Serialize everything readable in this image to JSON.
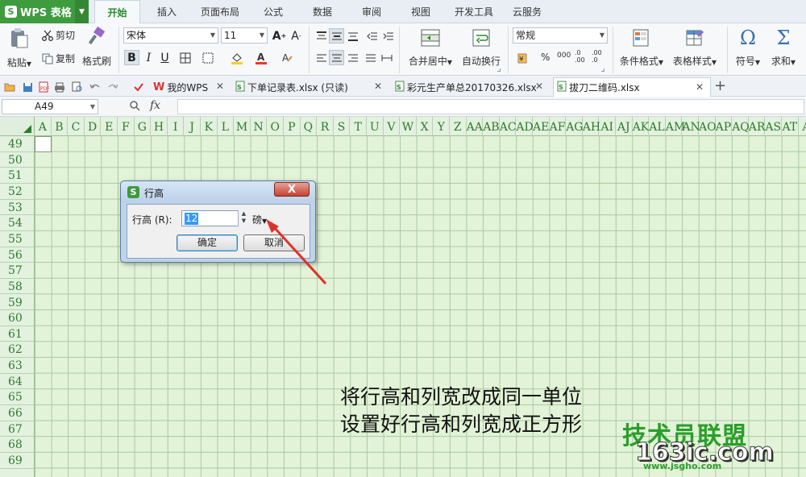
{
  "app": {
    "name": "WPS 表格",
    "logo_letter": "S"
  },
  "menu_tabs": [
    "开始",
    "插入",
    "页面布局",
    "公式",
    "数据",
    "审阅",
    "视图",
    "开发工具",
    "云服务"
  ],
  "active_tab": "开始",
  "ribbon": {
    "clipboard": {
      "paste": "粘贴",
      "cut": "剪切",
      "copy": "复制",
      "format_painter": "格式刷"
    },
    "font": {
      "name": "宋体",
      "size": "11",
      "bold": "B",
      "italic": "I",
      "underline": "U"
    },
    "merge_center": "合并居中",
    "wrap_text": "自动换行",
    "number_format": "常规",
    "percent": "%",
    "thousands": "000",
    "decimals_add": ".0 .00",
    "decimals_remove": ".00 .0",
    "conditional_format": "条件格式",
    "table_style": "表格样式",
    "symbol": "符号",
    "sum": "求和"
  },
  "doc_tabs": [
    {
      "label": "我的WPS",
      "kind": "wps"
    },
    {
      "label": "下单记录表.xlsx (只读)",
      "kind": "sheet"
    },
    {
      "label": "彩元生产单总20170326.xlsx",
      "kind": "sheet"
    },
    {
      "label": "拔刀二维码.xlsx",
      "kind": "sheet"
    }
  ],
  "active_doc": "拔刀二维码.xlsx",
  "formula_bar": {
    "cell": "A49",
    "fx": "fx"
  },
  "column_headers": [
    "A",
    "B",
    "C",
    "D",
    "E",
    "F",
    "G",
    "H",
    "I",
    "J",
    "K",
    "L",
    "M",
    "N",
    "O",
    "P",
    "Q",
    "R",
    "S",
    "T",
    "U",
    "V",
    "W",
    "X",
    "Y",
    "Z",
    "AA",
    "AB",
    "AC",
    "AD",
    "AE",
    "AF",
    "AG",
    "AH",
    "AI",
    "AJ",
    "AK",
    "AL",
    "AM",
    "AN",
    "AO",
    "AP",
    "AQ",
    "AR",
    "AS",
    "AT",
    "A"
  ],
  "row_headers": [
    "49",
    "50",
    "51",
    "52",
    "53",
    "54",
    "55",
    "56",
    "57",
    "58",
    "59",
    "60",
    "61",
    "62",
    "63",
    "64",
    "65",
    "66",
    "67",
    "68",
    "69"
  ],
  "dialog": {
    "title": "行高",
    "label": "行高 (R):",
    "value": "12",
    "unit": "磅",
    "ok": "确定",
    "cancel": "取消",
    "close": "X"
  },
  "caption": [
    "将行高和列宽改成同一单位",
    "设置好行高和列宽成正方形"
  ],
  "watermark": {
    "top": "技术员联盟",
    "site": "163ic.com",
    "url": "www.jsgho.com"
  },
  "colors": {
    "brand": "#3e9b3e",
    "grid_bg": "#e2f3d7",
    "header_text": "#2f7a2f",
    "arrow": "#e0302a"
  }
}
